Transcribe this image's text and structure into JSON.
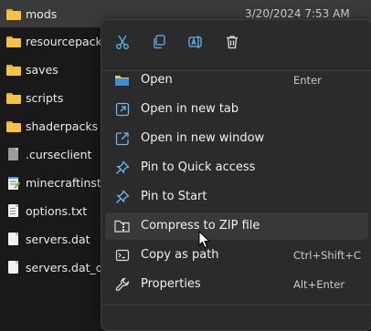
{
  "files": [
    {
      "name": "mods",
      "date": "3/20/2024 7:53 AM",
      "icon": "folder-icon",
      "selected": true
    },
    {
      "name": "resourcepacks",
      "icon": "folder-icon"
    },
    {
      "name": "saves",
      "icon": "folder-icon"
    },
    {
      "name": "scripts",
      "icon": "folder-icon"
    },
    {
      "name": "shaderpacks",
      "icon": "folder-icon"
    },
    {
      "name": ".curseclient",
      "icon": "file-icon"
    },
    {
      "name": "minecraftinstan",
      "icon": "notepad-file-icon"
    },
    {
      "name": "options.txt",
      "icon": "text-file-icon"
    },
    {
      "name": "servers.dat",
      "icon": "file-icon"
    },
    {
      "name": "servers.dat_old",
      "icon": "file-icon"
    }
  ],
  "context_menu": {
    "quick_actions": [
      {
        "name": "cut-icon"
      },
      {
        "name": "copy-icon"
      },
      {
        "name": "rename-icon"
      },
      {
        "name": "delete-icon"
      }
    ],
    "items": [
      {
        "label": "Open",
        "shortcut": "Enter",
        "icon": "open-folder-icon"
      },
      {
        "label": "Open in new tab",
        "shortcut": "",
        "icon": "new-tab-icon"
      },
      {
        "label": "Open in new window",
        "shortcut": "",
        "icon": "new-window-icon"
      },
      {
        "label": "Pin to Quick access",
        "shortcut": "",
        "icon": "pin-icon"
      },
      {
        "label": "Pin to Start",
        "shortcut": "",
        "icon": "pin-icon"
      },
      {
        "label": "Compress to ZIP file",
        "shortcut": "",
        "icon": "zip-icon",
        "hovered": true
      },
      {
        "label": "Copy as path",
        "shortcut": "Ctrl+Shift+C",
        "icon": "copy-path-icon"
      },
      {
        "label": "Properties",
        "shortcut": "Alt+Enter",
        "icon": "wrench-icon"
      }
    ]
  },
  "colors": {
    "background": "#191919",
    "menu_background": "#2b2b2b",
    "accent": "#4ea3e0",
    "folder": "#f5c242"
  }
}
